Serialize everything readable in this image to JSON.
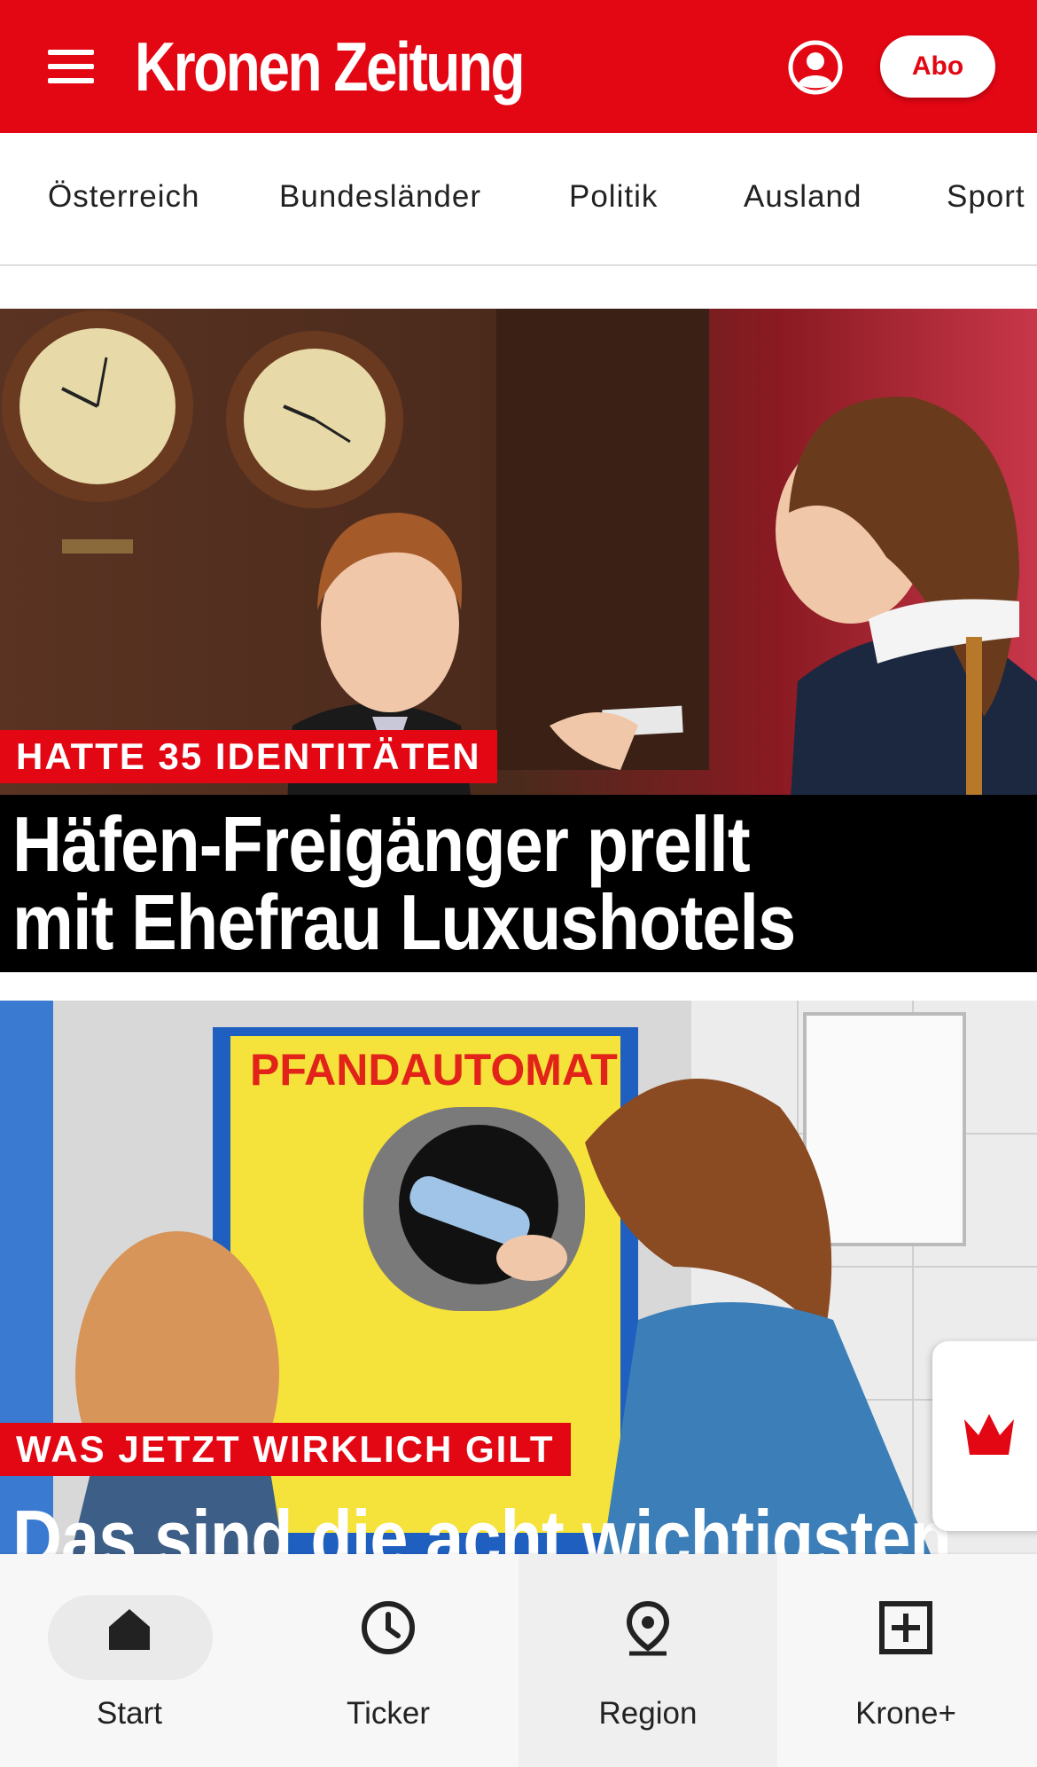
{
  "header": {
    "logo": "Kronen Zeitung",
    "abo_label": "Abo",
    "brand_color": "#e30613",
    "icons": {
      "menu": "hamburger-menu-icon",
      "user": "user-account-icon"
    }
  },
  "categories": [
    "Österreich",
    "Bundesländer",
    "Politik",
    "Ausland",
    "Sport"
  ],
  "articles": [
    {
      "kicker": "HATTE 35 IDENTITÄTEN",
      "headline_line1": "Häfen-Freigänger prellt",
      "headline_line2": "mit Ehefrau Luxushotels"
    },
    {
      "kicker": "WAS JETZT WIRKLICH GILT",
      "headline_line1": "Das sind die acht wichtigsten",
      "machine_text": "PFANDAUTOMAT"
    }
  ],
  "bottom_nav": {
    "tabs": [
      {
        "label": "Start",
        "icon": "home-icon",
        "active": true
      },
      {
        "label": "Ticker",
        "icon": "clock-icon",
        "active": false
      },
      {
        "label": "Region",
        "icon": "location-pin-icon",
        "active": false
      },
      {
        "label": "Krone+",
        "icon": "plus-box-icon",
        "active": false
      }
    ]
  }
}
